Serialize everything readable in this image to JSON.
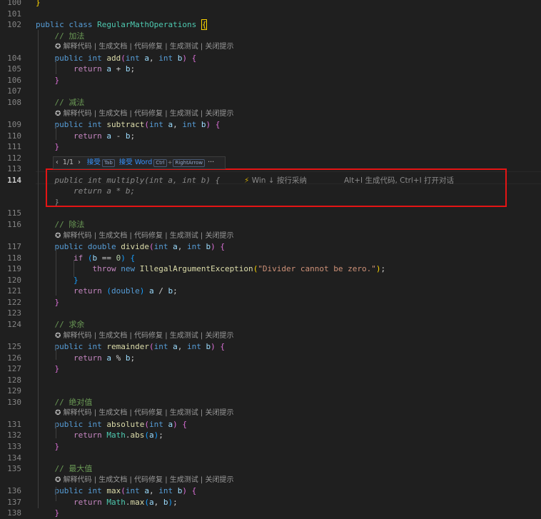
{
  "colors": {
    "background": "#1f1f1f",
    "keyword": "#569cd6",
    "control": "#c586c0",
    "type": "#4ec9b0",
    "function": "#dcdcaa",
    "parameter": "#9cdcfe",
    "string": "#ce9178",
    "number": "#b5cea8",
    "comment": "#6a9955",
    "highlight_box": "#e51414"
  },
  "codelens": {
    "icon": "ai-assistant-icon",
    "text": "解释代码 | 生成文档 | 代码修复 | 生成测试 | 关闭提示"
  },
  "suggestion_bar": {
    "prev": "‹",
    "counter": "1/1",
    "next": "›",
    "accept_label": "接受",
    "accept_key": "Tab",
    "accept_word_label": "接受 Word",
    "accept_word_key1": "Ctrl",
    "plus": "+",
    "accept_word_key2": "RightArrow",
    "more": "···"
  },
  "inline_hint": {
    "bolt": "⚡",
    "text1": "Win ↓ 按行采纳",
    "text2": "Alt+I 生成代码, Ctrl+I 打开对话"
  },
  "lines": [
    {
      "n": "100",
      "t": [
        [
          "br1",
          "}"
        ]
      ]
    },
    {
      "n": "101",
      "t": []
    },
    {
      "n": "102",
      "t": [
        [
          "kw",
          "public"
        ],
        [
          "",
          " "
        ],
        [
          "kw",
          "class"
        ],
        [
          "",
          " "
        ],
        [
          "typ",
          "RegularMathOperations"
        ],
        [
          "",
          " "
        ],
        [
          "br1 caretbox",
          "{"
        ]
      ]
    },
    {
      "n": "",
      "cmt": "    // 加法"
    },
    {
      "n": "",
      "lens": true
    },
    {
      "n": "104",
      "t": [
        [
          "",
          "    "
        ],
        [
          "kw",
          "public"
        ],
        [
          "",
          " "
        ],
        [
          "kw",
          "int"
        ],
        [
          "",
          " "
        ],
        [
          "fn",
          "add"
        ],
        [
          "br2",
          "("
        ],
        [
          "kw",
          "int"
        ],
        [
          "",
          " "
        ],
        [
          "par",
          "a"
        ],
        [
          "",
          ", "
        ],
        [
          "kw",
          "int"
        ],
        [
          "",
          " "
        ],
        [
          "par",
          "b"
        ],
        [
          "br2",
          ")"
        ],
        [
          "",
          " "
        ],
        [
          "br2",
          "{"
        ]
      ]
    },
    {
      "n": "105",
      "t": [
        [
          "",
          "        "
        ],
        [
          "ctl",
          "return"
        ],
        [
          "",
          " "
        ],
        [
          "par",
          "a"
        ],
        [
          "",
          " + "
        ],
        [
          "par",
          "b"
        ],
        [
          "",
          ";"
        ]
      ]
    },
    {
      "n": "106",
      "t": [
        [
          "",
          "    "
        ],
        [
          "br2",
          "}"
        ]
      ]
    },
    {
      "n": "107",
      "t": []
    },
    {
      "n": "108",
      "cmt": "    // 减法"
    },
    {
      "n": "",
      "lens": true
    },
    {
      "n": "109",
      "t": [
        [
          "",
          "    "
        ],
        [
          "kw",
          "public"
        ],
        [
          "",
          " "
        ],
        [
          "kw",
          "int"
        ],
        [
          "",
          " "
        ],
        [
          "fn",
          "subtract"
        ],
        [
          "br2",
          "("
        ],
        [
          "kw",
          "int"
        ],
        [
          "",
          " "
        ],
        [
          "par",
          "a"
        ],
        [
          "",
          ", "
        ],
        [
          "kw",
          "int"
        ],
        [
          "",
          " "
        ],
        [
          "par",
          "b"
        ],
        [
          "br2",
          ")"
        ],
        [
          "",
          " "
        ],
        [
          "br2",
          "{"
        ]
      ]
    },
    {
      "n": "110",
      "t": [
        [
          "",
          "        "
        ],
        [
          "ctl",
          "return"
        ],
        [
          "",
          " "
        ],
        [
          "par",
          "a"
        ],
        [
          "",
          " - "
        ],
        [
          "par",
          "b"
        ],
        [
          "",
          ";"
        ]
      ]
    },
    {
      "n": "111",
      "t": [
        [
          "",
          "    "
        ],
        [
          "br2",
          "}"
        ]
      ]
    },
    {
      "n": "112",
      "t": []
    },
    {
      "n": "113",
      "bar": true
    },
    {
      "n": "114",
      "active": true,
      "ghost": "    public int multiply(int a, int b) {",
      "hint": true
    },
    {
      "n": "",
      "ghost": "        return a * b;"
    },
    {
      "n": "",
      "ghost": "    }"
    },
    {
      "n": "115",
      "t": []
    },
    {
      "n": "116",
      "cmt": "    // 除法"
    },
    {
      "n": "",
      "lens": true
    },
    {
      "n": "117",
      "t": [
        [
          "",
          "    "
        ],
        [
          "kw",
          "public"
        ],
        [
          "",
          " "
        ],
        [
          "kw",
          "double"
        ],
        [
          "",
          " "
        ],
        [
          "fn",
          "divide"
        ],
        [
          "br2",
          "("
        ],
        [
          "kw",
          "int"
        ],
        [
          "",
          " "
        ],
        [
          "par",
          "a"
        ],
        [
          "",
          ", "
        ],
        [
          "kw",
          "int"
        ],
        [
          "",
          " "
        ],
        [
          "par",
          "b"
        ],
        [
          "br2",
          ")"
        ],
        [
          "",
          " "
        ],
        [
          "br2",
          "{"
        ]
      ]
    },
    {
      "n": "118",
      "t": [
        [
          "",
          "        "
        ],
        [
          "ctl",
          "if"
        ],
        [
          "",
          " "
        ],
        [
          "br3",
          "("
        ],
        [
          "par",
          "b"
        ],
        [
          "",
          " == "
        ],
        [
          "num",
          "0"
        ],
        [
          "br3",
          ")"
        ],
        [
          "",
          " "
        ],
        [
          "br3",
          "{"
        ]
      ]
    },
    {
      "n": "119",
      "t": [
        [
          "",
          "            "
        ],
        [
          "ctl",
          "throw"
        ],
        [
          "",
          " "
        ],
        [
          "kw",
          "new"
        ],
        [
          "",
          " "
        ],
        [
          "fn",
          "IllegalArgumentException"
        ],
        [
          "br1",
          "("
        ],
        [
          "str",
          "\"Divider cannot be zero.\""
        ],
        [
          "br1",
          ")"
        ],
        [
          "",
          ";"
        ]
      ]
    },
    {
      "n": "120",
      "t": [
        [
          "",
          "        "
        ],
        [
          "br3",
          "}"
        ]
      ]
    },
    {
      "n": "121",
      "t": [
        [
          "",
          "        "
        ],
        [
          "ctl",
          "return"
        ],
        [
          "",
          " "
        ],
        [
          "br3",
          "("
        ],
        [
          "kw",
          "double"
        ],
        [
          "br3",
          ")"
        ],
        [
          "",
          " "
        ],
        [
          "par",
          "a"
        ],
        [
          "",
          " / "
        ],
        [
          "par",
          "b"
        ],
        [
          "",
          ";"
        ]
      ]
    },
    {
      "n": "122",
      "t": [
        [
          "",
          "    "
        ],
        [
          "br2",
          "}"
        ]
      ]
    },
    {
      "n": "123",
      "t": []
    },
    {
      "n": "124",
      "cmt": "    // 求余"
    },
    {
      "n": "",
      "lens": true
    },
    {
      "n": "125",
      "t": [
        [
          "",
          "    "
        ],
        [
          "kw",
          "public"
        ],
        [
          "",
          " "
        ],
        [
          "kw",
          "int"
        ],
        [
          "",
          " "
        ],
        [
          "fn",
          "remainder"
        ],
        [
          "br2",
          "("
        ],
        [
          "kw",
          "int"
        ],
        [
          "",
          " "
        ],
        [
          "par",
          "a"
        ],
        [
          "",
          ", "
        ],
        [
          "kw",
          "int"
        ],
        [
          "",
          " "
        ],
        [
          "par",
          "b"
        ],
        [
          "br2",
          ")"
        ],
        [
          "",
          " "
        ],
        [
          "br2",
          "{"
        ]
      ]
    },
    {
      "n": "126",
      "t": [
        [
          "",
          "        "
        ],
        [
          "ctl",
          "return"
        ],
        [
          "",
          " "
        ],
        [
          "par",
          "a"
        ],
        [
          "",
          " % "
        ],
        [
          "par",
          "b"
        ],
        [
          "",
          ";"
        ]
      ]
    },
    {
      "n": "127",
      "t": [
        [
          "",
          "    "
        ],
        [
          "br2",
          "}"
        ]
      ]
    },
    {
      "n": "128",
      "t": []
    },
    {
      "n": "129",
      "t": []
    },
    {
      "n": "130",
      "cmt": "    // 绝对值"
    },
    {
      "n": "",
      "lens": true
    },
    {
      "n": "131",
      "t": [
        [
          "",
          "    "
        ],
        [
          "kw",
          "public"
        ],
        [
          "",
          " "
        ],
        [
          "kw",
          "int"
        ],
        [
          "",
          " "
        ],
        [
          "fn",
          "absolute"
        ],
        [
          "br2",
          "("
        ],
        [
          "kw",
          "int"
        ],
        [
          "",
          " "
        ],
        [
          "par",
          "a"
        ],
        [
          "br2",
          ")"
        ],
        [
          "",
          " "
        ],
        [
          "br2",
          "{"
        ]
      ]
    },
    {
      "n": "132",
      "t": [
        [
          "",
          "        "
        ],
        [
          "ctl",
          "return"
        ],
        [
          "",
          " "
        ],
        [
          "typ",
          "Math"
        ],
        [
          "",
          "."
        ],
        [
          "fn",
          "abs"
        ],
        [
          "br3",
          "("
        ],
        [
          "par",
          "a"
        ],
        [
          "br3",
          ")"
        ],
        [
          "",
          ";"
        ]
      ]
    },
    {
      "n": "133",
      "t": [
        [
          "",
          "    "
        ],
        [
          "br2",
          "}"
        ]
      ]
    },
    {
      "n": "134",
      "t": []
    },
    {
      "n": "135",
      "cmt": "    // 最大值"
    },
    {
      "n": "",
      "lens": true
    },
    {
      "n": "136",
      "t": [
        [
          "",
          "    "
        ],
        [
          "kw",
          "public"
        ],
        [
          "",
          " "
        ],
        [
          "kw",
          "int"
        ],
        [
          "",
          " "
        ],
        [
          "fn",
          "max"
        ],
        [
          "br2",
          "("
        ],
        [
          "kw",
          "int"
        ],
        [
          "",
          " "
        ],
        [
          "par",
          "a"
        ],
        [
          "",
          ", "
        ],
        [
          "kw",
          "int"
        ],
        [
          "",
          " "
        ],
        [
          "par",
          "b"
        ],
        [
          "br2",
          ")"
        ],
        [
          "",
          " "
        ],
        [
          "br2",
          "{"
        ]
      ]
    },
    {
      "n": "137",
      "t": [
        [
          "",
          "        "
        ],
        [
          "ctl",
          "return"
        ],
        [
          "",
          " "
        ],
        [
          "typ",
          "Math"
        ],
        [
          "",
          "."
        ],
        [
          "fn",
          "max"
        ],
        [
          "br3",
          "("
        ],
        [
          "par",
          "a"
        ],
        [
          "",
          ", "
        ],
        [
          "par",
          "b"
        ],
        [
          "br3",
          ")"
        ],
        [
          "",
          ";"
        ]
      ]
    },
    {
      "n": "138",
      "t": [
        [
          "",
          "    "
        ],
        [
          "br2",
          "}"
        ]
      ]
    }
  ]
}
